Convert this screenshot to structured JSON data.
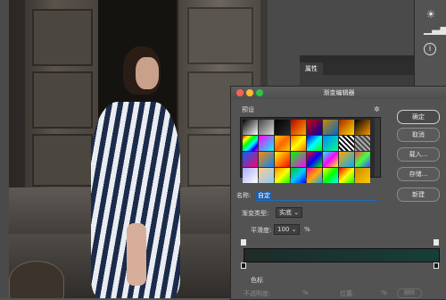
{
  "properties_panel": {
    "tab_label": "属性"
  },
  "dialog": {
    "title": "渐变编辑器",
    "presets_label": "预设",
    "buttons": {
      "ok": "确定",
      "cancel": "取消",
      "load": "载入...",
      "save": "存储...",
      "new": "新建"
    },
    "name_label": "名称:",
    "name_value": "自定",
    "gradient_type_label": "渐变类型:",
    "gradient_type_value": "实底",
    "smoothness_label": "平滑度:",
    "smoothness_value": "100",
    "smoothness_unit": "%",
    "color_stops_label": "色标",
    "opacity_label": "不透明度:",
    "opacity_unit": "%",
    "location_label": "位置:",
    "location_unit": "%",
    "delete_label": "删除",
    "gradient_colors": [
      "#1e2b29",
      "#173e39"
    ]
  },
  "preset_swatches": [
    "linear-gradient(135deg,#000,#fff)",
    "linear-gradient(135deg,#444,#ddd)",
    "linear-gradient(135deg,#000,transparent)",
    "linear-gradient(135deg,#b00,#fa0)",
    "linear-gradient(135deg,#c00,#00a)",
    "linear-gradient(135deg,#c80,#06c)",
    "linear-gradient(135deg,#a20,#fd0)",
    "linear-gradient(135deg,#000,#f90)",
    "linear-gradient(135deg,#f00,#ff0,#0f0,#0ff,#00f,#f0f)",
    "linear-gradient(135deg,#f0f,#0ff)",
    "linear-gradient(135deg,#fc0,#f60,#fc0)",
    "linear-gradient(135deg,#f60,#ff0,#f60)",
    "linear-gradient(135deg,#00f,#0ff,#0f0)",
    "linear-gradient(135deg,#08f,#0f8)",
    "repeating-linear-gradient(45deg,#fff 0 2px,#000 2px 4px)",
    "repeating-linear-gradient(45deg,#aaa 0 2px,#444 2px 4px)",
    "linear-gradient(135deg,#06f,#f06)",
    "linear-gradient(135deg,#f80,#08f)",
    "linear-gradient(135deg,#ff0,#f00)",
    "linear-gradient(135deg,#0f0,#f0f)",
    "linear-gradient(135deg,#f00,#00f,#0f0)",
    "linear-gradient(135deg,#0ff,#f0f,#ff0)",
    "linear-gradient(135deg,#fa0,#0af)",
    "linear-gradient(135deg,#f44,#4f4,#44f)",
    "linear-gradient(135deg,#aaf,#fff)",
    "linear-gradient(135deg,#fc8,#8cf)",
    "linear-gradient(135deg,#f80,#ff0,#0f0)",
    "linear-gradient(135deg,#0c0,#0cf,#00f)",
    "linear-gradient(135deg,#f0a,#fa0,#0af)",
    "linear-gradient(135deg,#ff0,#0f0,#0ff)",
    "linear-gradient(135deg,#f00,#ff0,#0f0)",
    "linear-gradient(135deg,#c80,#fc0)"
  ]
}
